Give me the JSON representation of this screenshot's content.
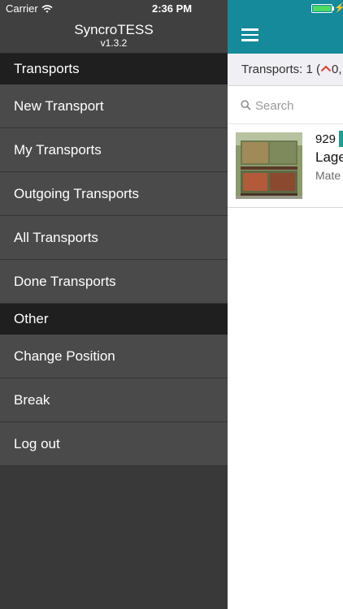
{
  "status_bar": {
    "carrier": "Carrier",
    "time": "2:36 PM",
    "wifi_icon": "wifi-icon",
    "battery_icon": "battery-charging-icon",
    "battery_level": 1.0,
    "battery_color": "#4cd964"
  },
  "drawer": {
    "app_title": "SyncroTESS",
    "app_version": "v1.3.2",
    "sections": [
      {
        "header": "Transports",
        "items": [
          {
            "label": "New Transport"
          },
          {
            "label": "My Transports"
          },
          {
            "label": "Outgoing Transports"
          },
          {
            "label": "All Transports"
          },
          {
            "label": "Done Transports"
          }
        ]
      },
      {
        "header": "Other",
        "items": [
          {
            "label": "Change Position"
          },
          {
            "label": "Break"
          },
          {
            "label": "Log out"
          }
        ]
      }
    ]
  },
  "main": {
    "accent_color": "#148a9b",
    "menu_icon": "hamburger-menu-icon",
    "count_label": "Transports: 1 (",
    "count_suffix": "0,",
    "count_icon": "chevron-up-icon",
    "search": {
      "placeholder": "Search",
      "value": ""
    },
    "transports": [
      {
        "number": "929",
        "title": "Lage",
        "subtitle": "Mate",
        "badge_color": "#1aa095",
        "image": "pallet-cages-photo"
      }
    ]
  }
}
